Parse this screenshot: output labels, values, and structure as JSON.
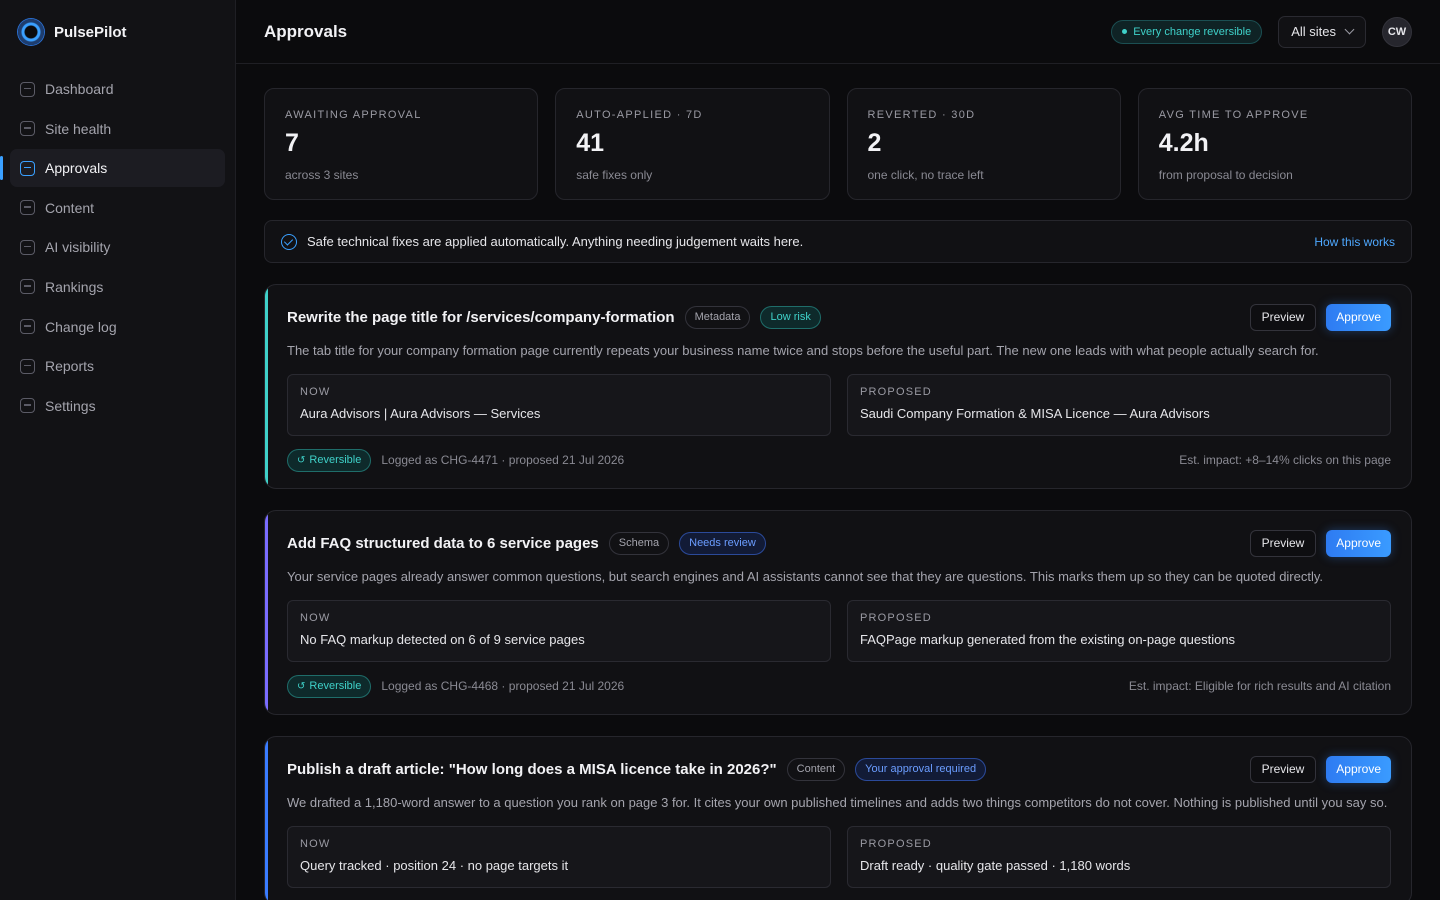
{
  "brand": {
    "name": "PulsePilot"
  },
  "sidebar": {
    "items": [
      {
        "label": "Dashboard",
        "active": false
      },
      {
        "label": "Site health",
        "active": false
      },
      {
        "label": "Approvals",
        "active": true
      },
      {
        "label": "Content",
        "active": false
      },
      {
        "label": "AI visibility",
        "active": false
      },
      {
        "label": "Rankings",
        "active": false
      },
      {
        "label": "Change log",
        "active": false
      },
      {
        "label": "Reports",
        "active": false
      },
      {
        "label": "Settings",
        "active": false
      }
    ]
  },
  "header": {
    "title": "Approvals",
    "reversible_pill": "Every change reversible",
    "site_select": "All sites",
    "avatar": "CW"
  },
  "stats": [
    {
      "label": "Awaiting approval",
      "value": "7",
      "sub": "across 3 sites"
    },
    {
      "label": "Auto-applied · 7d",
      "value": "41",
      "sub": "safe fixes only"
    },
    {
      "label": "Reverted · 30d",
      "value": "2",
      "sub": "one click, no trace left"
    },
    {
      "label": "Avg time to approve",
      "value": "4.2h",
      "sub": "from proposal to decision"
    }
  ],
  "info_bar": {
    "text": "Safe technical fixes are applied automatically. Anything needing judgement waits here.",
    "link": "How this works"
  },
  "actions": {
    "preview": "Preview",
    "approve": "Approve"
  },
  "labels": {
    "now": "NOW",
    "proposed": "PROPOSED",
    "reversible": "Reversible",
    "undo_glyph": "↺"
  },
  "cards": [
    {
      "title": "Rewrite the page title for /services/company-formation",
      "category": "Metadata",
      "risk": "Low risk",
      "description": "The tab title for your company formation page currently repeats your business name twice and stops before the useful part. The new one leads with what people actually search for.",
      "now": "Aura Advisors | Aura Advisors — Services",
      "proposed": "Saudi Company Formation & MISA Licence — Aura Advisors",
      "log": "Logged as CHG-4471 · proposed 21 Jul 2026",
      "impact": "Est. impact: +8–14% clicks on this page"
    },
    {
      "title": "Add FAQ structured data to 6 service pages",
      "category": "Schema",
      "risk": "Needs review",
      "description": "Your service pages already answer common questions, but search engines and AI assistants cannot see that they are questions. This marks them up so they can be quoted directly.",
      "now": "No FAQ markup detected on 6 of 9 service pages",
      "proposed": "FAQPage markup generated from the existing on-page questions",
      "log": "Logged as CHG-4468 · proposed 21 Jul 2026",
      "impact": "Est. impact: Eligible for rich results and AI citation"
    },
    {
      "title": "Publish a draft article: \"How long does a MISA licence take in 2026?\"",
      "category": "Content",
      "risk": "Your approval required",
      "description": "We drafted a 1,180-word answer to a question you rank on page 3 for. It cites your own published timelines and adds two things competitors do not cover. Nothing is published until you say so.",
      "now": "Query tracked · position 24 · no page targets it",
      "proposed": "Draft ready · quality gate passed · 1,180 words"
    }
  ]
}
